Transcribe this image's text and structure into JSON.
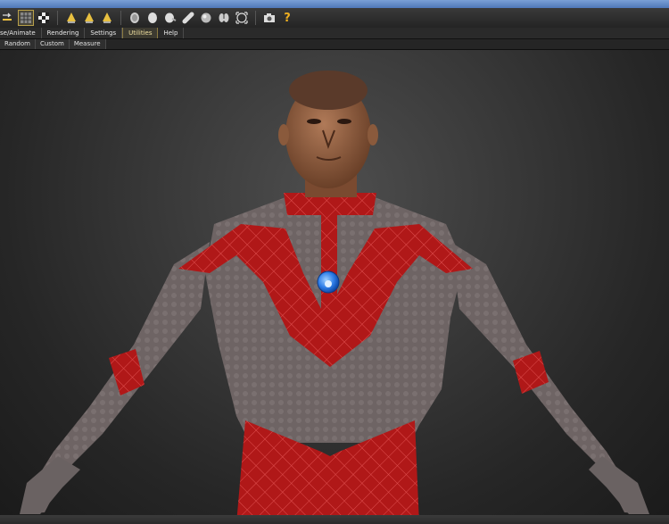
{
  "menu_tabs": [
    {
      "label": "se/Animate"
    },
    {
      "label": "Rendering"
    },
    {
      "label": "Settings"
    },
    {
      "label": "Utilities"
    },
    {
      "label": "Help"
    }
  ],
  "active_tab": "Utilities",
  "sub_tabs": [
    {
      "label": "Random"
    },
    {
      "label": "Custom"
    },
    {
      "label": "Measure"
    }
  ],
  "toolbar_icons": [
    "tool-arrow-icon",
    "grid-icon",
    "checker-icon",
    "cone-light-icon",
    "cone-light-icon",
    "cone-light-icon",
    "head-front-icon",
    "head-side-icon",
    "head-tilt-icon",
    "head-back-icon",
    "sphere-icon",
    "lungs-icon",
    "frame-icon",
    "camera-icon",
    "help-icon"
  ],
  "colors": {
    "accent": "#b8a04a",
    "suit_red": "#b01818",
    "suit_grey": "#6e6464",
    "skin": "#8a5a3c",
    "marker_blue": "#2f7ee8"
  },
  "help_glyph": "?"
}
